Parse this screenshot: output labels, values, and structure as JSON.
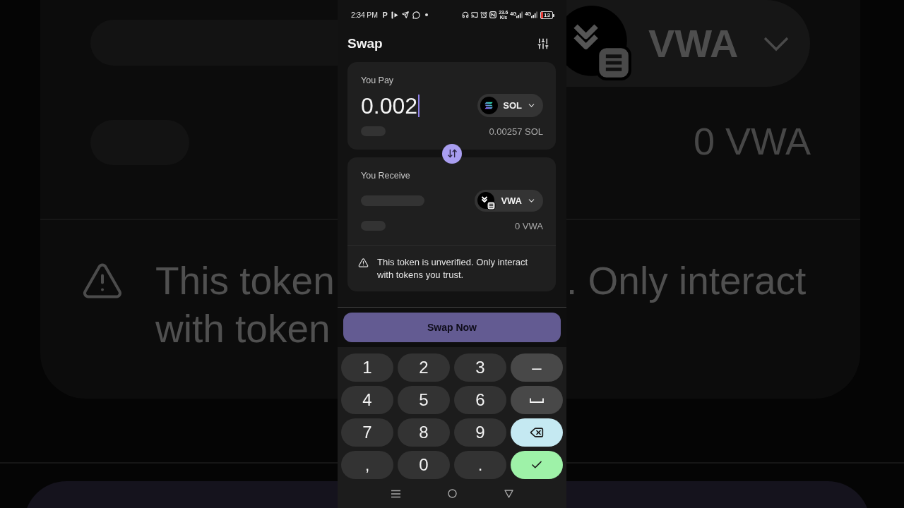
{
  "backdrop": {
    "left": {
      "warning_lines": [
        "This token",
        "with token"
      ]
    },
    "right": {
      "token": "VWA",
      "balance": "0 VWA",
      "warning_fragment": ". Only interact"
    }
  },
  "status_bar": {
    "time": "2:34 PM",
    "app_letter": "P",
    "net_speed": "23.6",
    "net_unit": "K/s",
    "networks": [
      "4G",
      "4G"
    ],
    "battery": "13"
  },
  "header": {
    "title": "Swap"
  },
  "pay": {
    "label": "You Pay",
    "amount": "0.002",
    "token": "SOL",
    "balance": "0.00257 SOL"
  },
  "receive": {
    "label": "You Receive",
    "token": "VWA",
    "balance": "0 VWA",
    "warning": "This token is unverified. Only interact with tokens you trust."
  },
  "swap_button": {
    "label": "Swap Now",
    "disabled": true
  },
  "keypad": {
    "rows": [
      [
        {
          "kind": "digit",
          "label": "1"
        },
        {
          "kind": "digit",
          "label": "2"
        },
        {
          "kind": "digit",
          "label": "3"
        },
        {
          "kind": "symbol",
          "label": "–"
        }
      ],
      [
        {
          "kind": "digit",
          "label": "4"
        },
        {
          "kind": "digit",
          "label": "5"
        },
        {
          "kind": "digit",
          "label": "6"
        },
        {
          "kind": "space"
        }
      ],
      [
        {
          "kind": "digit",
          "label": "7"
        },
        {
          "kind": "digit",
          "label": "8"
        },
        {
          "kind": "digit",
          "label": "9"
        },
        {
          "kind": "backspace"
        }
      ],
      [
        {
          "kind": "digit",
          "label": ","
        },
        {
          "kind": "digit",
          "label": "0"
        },
        {
          "kind": "digit",
          "label": "."
        },
        {
          "kind": "enter"
        }
      ]
    ]
  }
}
